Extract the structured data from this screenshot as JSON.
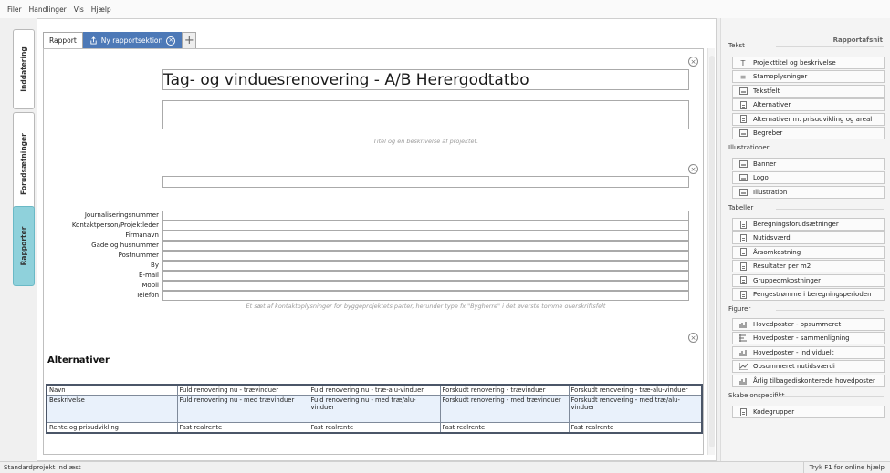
{
  "menu": [
    "Filer",
    "Handlinger",
    "Vis",
    "Hjælp"
  ],
  "left_tabs": [
    "Inddatering",
    "Forudsætninger",
    "Rapporter"
  ],
  "tabs": {
    "report": "Rapport",
    "new_section": "Ny rapportsektion",
    "add": "+"
  },
  "report": {
    "title": "Tag- og vinduesrenovering - A/B Herergodtatbo",
    "title_hint": "Titel og en beskrivelse af projektet.",
    "contact_fields": [
      "Journaliseringsnummer",
      "Kontaktperson/Projektleder",
      "Firmanavn",
      "Gade og husnummer",
      "Postnummer",
      "By",
      "E-mail",
      "Mobil",
      "Telefon"
    ],
    "contact_hint": "Et sæt af kontaktoplysninger for byggeprojektets parter, herunder type fx \"Bygherre\" i det øverste tomme overskriftsfelt",
    "alternatives_heading": "Alternativer",
    "table": {
      "header": [
        "Navn",
        "Fuld renovering nu - trævinduer",
        "Fuld renovering nu - træ-alu-vinduer",
        "Forskudt renovering - trævinduer",
        "Forskudt renovering - træ-alu-vinduer"
      ],
      "description": [
        "Beskrivelse",
        "Fuld renovering nu - med trævinduer",
        "Fuld renovering nu - med træ/alu-vinduer",
        "Forskudt renovering - med trævinduer",
        "Forskudt renovering - med træ/alu-vinduer"
      ],
      "rate": [
        "Rente og prisudvikling",
        "Fast realrente",
        "Fast realrente",
        "Fast realrente",
        "Fast realrente"
      ]
    }
  },
  "sidebar": {
    "title": "Rapportafsnit",
    "groups": [
      {
        "label": "Tekst",
        "items": [
          {
            "label": "Projekttitel og beskrivelse",
            "icon": "text-icon"
          },
          {
            "label": "Stamoplysninger",
            "icon": "list-icon"
          },
          {
            "label": "Tekstfelt",
            "icon": "textfield-icon"
          },
          {
            "label": "Alternativer",
            "icon": "document-icon"
          },
          {
            "label": "Alternativer m. prisudvikling og areal",
            "icon": "document-icon"
          },
          {
            "label": "Begreber",
            "icon": "textfield-icon"
          }
        ]
      },
      {
        "label": "Illustrationer",
        "items": [
          {
            "label": "Banner",
            "icon": "image-icon"
          },
          {
            "label": "Logo",
            "icon": "image-icon"
          },
          {
            "label": "Illustration",
            "icon": "image-icon"
          }
        ]
      },
      {
        "label": "Tabeller",
        "items": [
          {
            "label": "Beregningsforudsætninger",
            "icon": "document-icon"
          },
          {
            "label": "Nutidsværdi",
            "icon": "document-icon"
          },
          {
            "label": "Årsomkostning",
            "icon": "document-icon"
          },
          {
            "label": "Resultater per m2",
            "icon": "document-icon"
          },
          {
            "label": "Gruppeomkostninger",
            "icon": "document-icon"
          },
          {
            "label": "Pengestrømme i beregningsperioden",
            "icon": "document-icon"
          }
        ]
      },
      {
        "label": "Figurer",
        "items": [
          {
            "label": "Hovedposter - opsummeret",
            "icon": "bar-chart-icon"
          },
          {
            "label": "Hovedposter - sammenligning",
            "icon": "hbar-chart-icon"
          },
          {
            "label": "Hovedposter - individuelt",
            "icon": "bar-chart-icon"
          },
          {
            "label": "Opsummeret nutidsværdi",
            "icon": "line-chart-icon"
          },
          {
            "label": "Årlig tilbagediskonterede hovedposter",
            "icon": "bar-chart-icon"
          }
        ]
      },
      {
        "label": "Skabelonspecifikt",
        "items": [
          {
            "label": "Kodegrupper",
            "icon": "document-icon"
          }
        ]
      }
    ]
  },
  "status": {
    "left": "Standardprojekt indlæst",
    "right": "Tryk F1 for online hjælp"
  }
}
